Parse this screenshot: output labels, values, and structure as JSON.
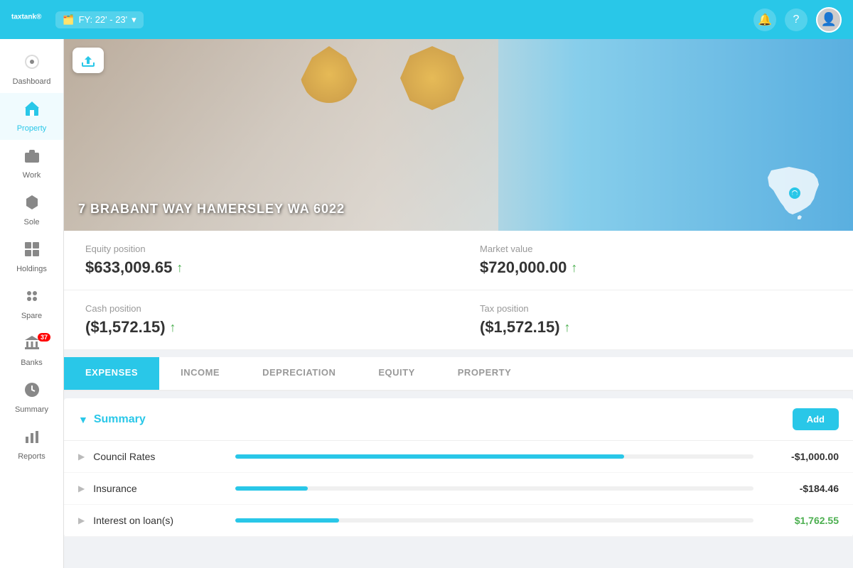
{
  "header": {
    "logo": "taxtank",
    "logo_reg": "®",
    "fy_label": "FY: 22' - 23'",
    "fy_icon": "🗂️"
  },
  "sidebar": {
    "items": [
      {
        "id": "dashboard",
        "label": "Dashboard",
        "icon": "⊕",
        "active": false
      },
      {
        "id": "property",
        "label": "Property",
        "icon": "🏠",
        "active": true
      },
      {
        "id": "work",
        "label": "Work",
        "icon": "💼",
        "active": false
      },
      {
        "id": "sole",
        "label": "Sole",
        "icon": "🛡️",
        "active": false
      },
      {
        "id": "holdings",
        "label": "Holdings",
        "icon": "💹",
        "active": false
      },
      {
        "id": "spare",
        "label": "Spare",
        "icon": "⚙️",
        "active": false
      },
      {
        "id": "banks",
        "label": "Banks",
        "icon": "🏦",
        "active": false,
        "badge": "37"
      },
      {
        "id": "summary",
        "label": "Summary",
        "icon": "💲",
        "active": false
      },
      {
        "id": "reports",
        "label": "Reports",
        "icon": "📊",
        "active": false
      }
    ]
  },
  "property": {
    "address": "7 BRABANT WAY HAMERSLEY WA 6022",
    "equity_position_label": "Equity position",
    "equity_position_value": "$633,009.65",
    "equity_trend": "up",
    "market_value_label": "Market value",
    "market_value_value": "$720,000.00",
    "market_trend": "up",
    "cash_position_label": "Cash position",
    "cash_position_value": "($1,572.15)",
    "cash_trend": "up",
    "tax_position_label": "Tax position",
    "tax_position_value": "($1,572.15)",
    "tax_trend": "up"
  },
  "tabs": [
    {
      "id": "expenses",
      "label": "EXPENSES",
      "active": true
    },
    {
      "id": "income",
      "label": "INCOME",
      "active": false
    },
    {
      "id": "depreciation",
      "label": "DEPRECIATION",
      "active": false
    },
    {
      "id": "equity",
      "label": "EQUITY",
      "active": false
    },
    {
      "id": "property",
      "label": "PROPERTY",
      "active": false
    }
  ],
  "summary_section": {
    "title": "Summary",
    "add_button": "Add",
    "expenses": [
      {
        "name": "Council Rates",
        "amount": "-$1,000.00",
        "bar_pct": 75,
        "positive": false
      },
      {
        "name": "Insurance",
        "amount": "-$184.46",
        "bar_pct": 14,
        "positive": false
      },
      {
        "name": "Interest on loan(s)",
        "amount": "$1,762.55",
        "bar_pct": 20,
        "positive": true
      }
    ]
  }
}
